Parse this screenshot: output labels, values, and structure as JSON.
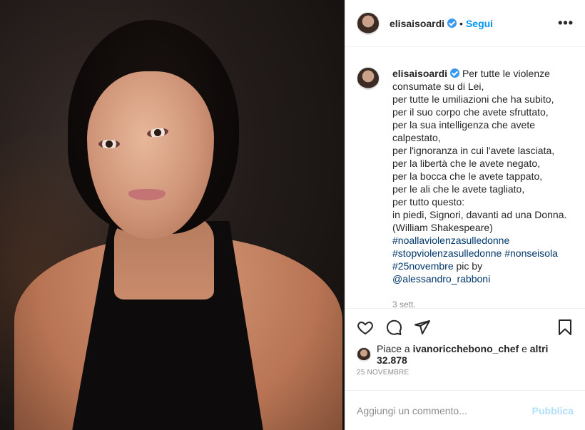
{
  "post": {
    "username": "elisaisoardi",
    "follow_label": "Segui",
    "dot": "•",
    "more_label": "•••",
    "caption": {
      "text": "Per tutte le violenze consumate su di Lei,\nper tutte le umiliazioni che ha subito,\nper il suo corpo che avete sfruttato,\nper la sua intelligenza che avete calpestato,\nper l'ignoranza in cui l'avete lasciata,\nper la libertà che le avete negato,\nper la bocca che le avete tappato,\nper le ali che le avete tagliato,\nper tutto questo:\nin piedi, Signori, davanti ad una Donna. (William Shakespeare)",
      "hashtag1": "#noallaviolenzasulledonne",
      "hashtag2": "#stopviolenzasulledonne",
      "hashtag3": "#nonseisola",
      "hashtag4": "#25novembre",
      "pic_by": " pic by",
      "mention": "@alessandro_rabboni"
    },
    "time_ago": "3 sett.",
    "likes": {
      "prefix": "Piace a ",
      "user": "ivanoricchebono_chef",
      "middle": " e ",
      "others": "altri 32.878"
    },
    "date": "25 NOVEMBRE",
    "comment": {
      "placeholder": "Aggiungi un commento...",
      "publish_label": "Pubblica"
    },
    "icons": {
      "like": "heart-icon",
      "comment": "comment-icon",
      "share": "share-icon",
      "save": "bookmark-icon",
      "verified": "verified-badge-icon"
    },
    "colors": {
      "link": "#0095f6",
      "hashtag": "#00376b",
      "verified": "#3897f0",
      "publish_disabled": "#b2dffc"
    }
  }
}
